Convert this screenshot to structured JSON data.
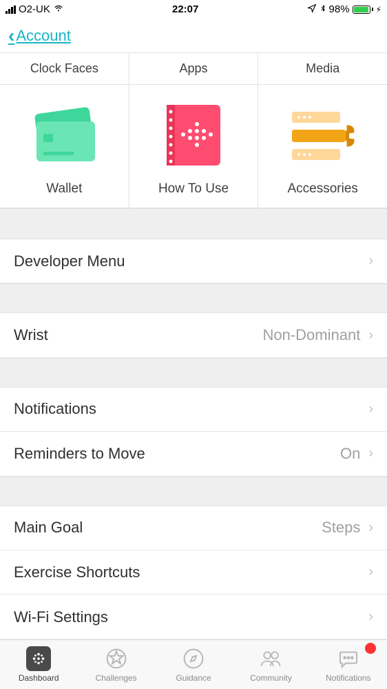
{
  "status": {
    "carrier": "O2-UK",
    "time": "22:07",
    "battery": "98%"
  },
  "nav": {
    "back": "Account"
  },
  "categories": [
    "Clock Faces",
    "Apps",
    "Media"
  ],
  "tiles": [
    {
      "label": "Wallet"
    },
    {
      "label": "How To Use"
    },
    {
      "label": "Accessories"
    }
  ],
  "rows": {
    "developer": {
      "label": "Developer Menu"
    },
    "wrist": {
      "label": "Wrist",
      "value": "Non-Dominant"
    },
    "notifications": {
      "label": "Notifications"
    },
    "reminders": {
      "label": "Reminders to Move",
      "value": "On"
    },
    "mainGoal": {
      "label": "Main Goal",
      "value": "Steps"
    },
    "exercise": {
      "label": "Exercise Shortcuts"
    },
    "wifi": {
      "label": "Wi-Fi Settings"
    }
  },
  "tabs": [
    {
      "label": "Dashboard"
    },
    {
      "label": "Challenges"
    },
    {
      "label": "Guidance"
    },
    {
      "label": "Community"
    },
    {
      "label": "Notifications"
    }
  ]
}
